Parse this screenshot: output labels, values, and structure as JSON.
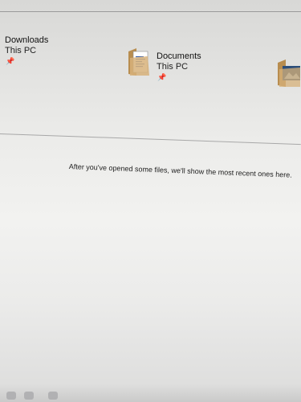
{
  "quick_access": [
    {
      "name": "Downloads",
      "location": "This PC",
      "pinned": true,
      "icon": "downloads-folder-icon"
    },
    {
      "name": "Documents",
      "location": "This PC",
      "pinned": true,
      "icon": "documents-folder-icon"
    },
    {
      "name": "",
      "location": "",
      "pinned": false,
      "icon": "pictures-folder-icon"
    }
  ],
  "recent": {
    "empty_message": "After you've opened some files, we'll show the most recent ones here."
  },
  "icons": {
    "pin": "📌"
  },
  "colors": {
    "folder_tan": "#c9a46a",
    "folder_dark": "#a88246",
    "document_blue": "#3a5fa8",
    "background": "#ececea"
  }
}
